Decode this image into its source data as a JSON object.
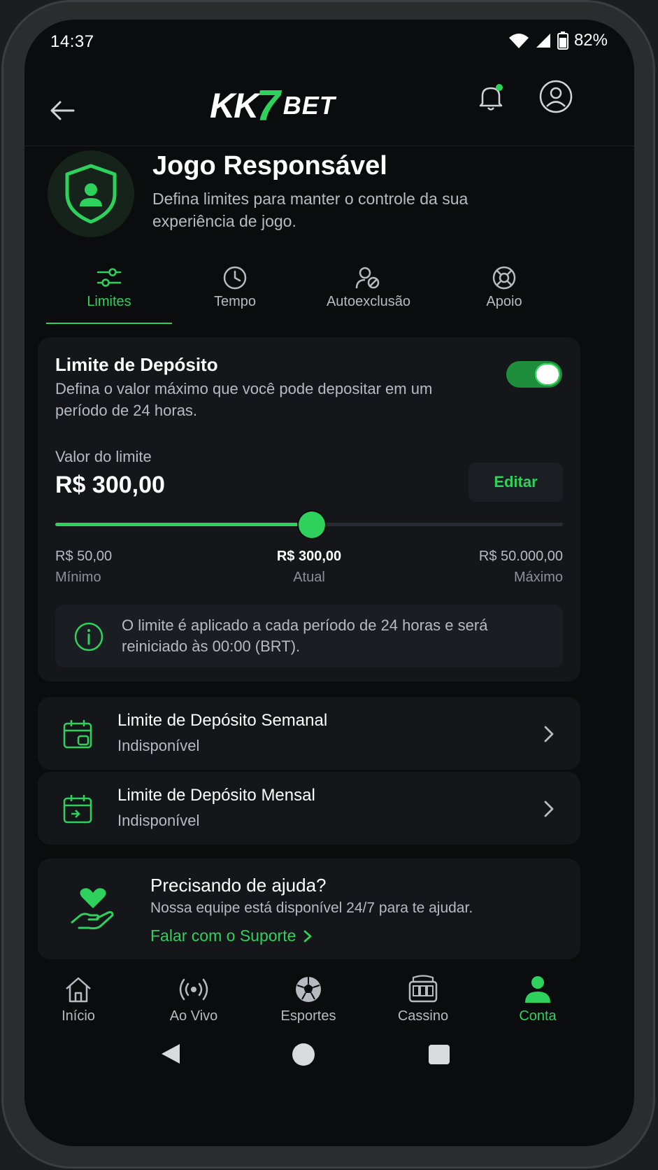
{
  "status": {
    "time": "14:37",
    "battery": "82%"
  },
  "brand": {
    "kk": "KK",
    "seven": "7",
    "bet": "BET",
    "accent": "#2ed15c"
  },
  "icons": {
    "back": "arrow-left-icon",
    "bell": "bell-icon",
    "profile": "user-circle-icon",
    "shield": "shield-user-icon",
    "info": "info-icon",
    "calendar": "calendar-icon",
    "chevron": "chevron-right-icon",
    "help": "heart-hand-icon"
  },
  "page": {
    "title": "Jogo Responsável",
    "subtitle": "Defina limites para manter o controle da sua experiência de jogo."
  },
  "tabs": [
    {
      "label": "Limites",
      "icon": "sliders-icon",
      "active": true
    },
    {
      "label": "Tempo",
      "icon": "clock-icon",
      "active": false
    },
    {
      "label": "Autoexclusão",
      "icon": "user-block-icon",
      "active": false
    },
    {
      "label": "Apoio",
      "icon": "lifebuoy-icon",
      "active": false
    }
  ],
  "deposit_limit": {
    "title": "Limite de Depósito",
    "description": "Defina o valor máximo que você pode depositar em um período de 24 horas.",
    "enabled": true,
    "value_label": "Valor do limite",
    "value": "R$ 300,00",
    "edit_label": "Editar",
    "slider_fraction": 0.505,
    "min_value": "R$ 50,00",
    "min_caption": "Mínimo",
    "current_value": "R$ 300,00",
    "current_caption": "Atual",
    "max_value": "R$ 50.000,00",
    "max_caption": "Máximo",
    "info": "O limite é aplicado a cada período de 24 horas e será reiniciado às 00:00 (BRT)."
  },
  "limit_rows": [
    {
      "title": "Limite de Depósito Semanal",
      "status": "Indisponível"
    },
    {
      "title": "Limite de Depósito Mensal",
      "status": "Indisponível"
    }
  ],
  "help": {
    "title": "Precisando de ajuda?",
    "subtitle": "Nossa equipe está disponível 24/7 para te ajudar.",
    "link": "Falar com o Suporte"
  },
  "nav": [
    {
      "label": "Início",
      "icon": "home-icon",
      "active": false
    },
    {
      "label": "Ao Vivo",
      "icon": "live-icon",
      "active": false
    },
    {
      "label": "Esportes",
      "icon": "soccer-ball-icon",
      "active": false
    },
    {
      "label": "Cassino",
      "icon": "slot-machine-icon",
      "active": false
    },
    {
      "label": "Conta",
      "icon": "user-icon",
      "active": true
    }
  ]
}
